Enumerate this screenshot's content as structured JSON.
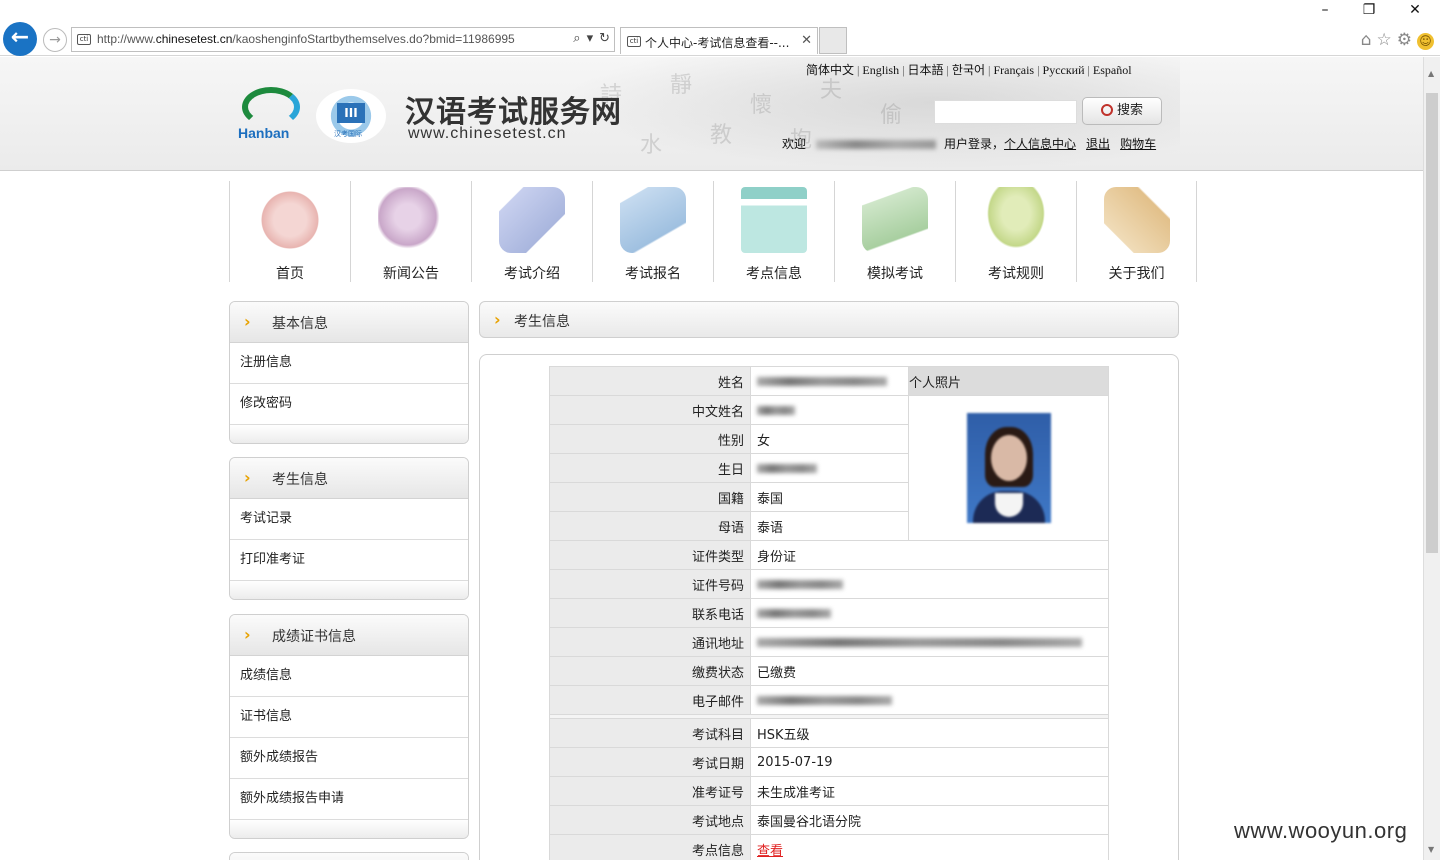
{
  "window": {
    "minimize": "–",
    "restore": "❐",
    "close": "✕"
  },
  "browser": {
    "url_prefix": "http://www.",
    "url_domain": "chinesetest.cn",
    "url_path": "/kaoshenginfoStartbythemselves.do?bmid=11986995",
    "favicon_text": "cti",
    "tab_title": "个人中心-考试信息查看--...",
    "icons": [
      "back-arrow-icon",
      "forward-arrow-icon",
      "search-icon",
      "dropdown-icon",
      "refresh-icon",
      "home-icon",
      "star-icon",
      "gear-icon",
      "smiley-icon"
    ]
  },
  "header": {
    "site_title": "汉语考试服务网",
    "site_url": "www.chinesetest.cn",
    "logo_text": "Hanban",
    "logo2_caption": "汉考国际",
    "languages": [
      "简体中文",
      "English",
      "日本語",
      "한국어",
      "Français",
      "Русский",
      "Español"
    ],
    "search_button": "搜索",
    "welcome": "欢迎",
    "user_login": "用户登录，",
    "personal_center": "个人信息中心",
    "logout": "退出",
    "cart": "购物车"
  },
  "nav": {
    "items": [
      {
        "label": "首页",
        "color": "#e8b4b0"
      },
      {
        "label": "新闻公告",
        "color": "#c9a7c9"
      },
      {
        "label": "考试介绍",
        "color": "#a9b6de"
      },
      {
        "label": "考试报名",
        "color": "#9fc0e0"
      },
      {
        "label": "考点信息",
        "color": "#8fd0c8"
      },
      {
        "label": "模拟考试",
        "color": "#a8cfa0"
      },
      {
        "label": "考试规则",
        "color": "#c4d88a"
      },
      {
        "label": "关于我们",
        "color": "#e2c08a"
      }
    ]
  },
  "sidebar": {
    "panels": [
      {
        "title": "基本信息",
        "items": [
          "注册信息",
          "修改密码"
        ]
      },
      {
        "title": "考生信息",
        "items": [
          "考试记录",
          "打印准考证"
        ]
      },
      {
        "title": "成绩证书信息",
        "items": [
          "成绩信息",
          "证书信息",
          "额外成绩报告",
          "额外成绩报告申请"
        ]
      }
    ]
  },
  "main": {
    "title": "考生信息",
    "photo_label": "个人照片",
    "rows_personal": [
      {
        "label": "姓名",
        "value": ""
      },
      {
        "label": "中文姓名",
        "value": ""
      },
      {
        "label": "性别",
        "value": "女"
      },
      {
        "label": "生日",
        "value": ""
      },
      {
        "label": "国籍",
        "value": "泰国"
      },
      {
        "label": "母语",
        "value": "泰语"
      }
    ],
    "rows_contact": [
      {
        "label": "证件类型",
        "value": "身份证"
      },
      {
        "label": "证件号码",
        "value": ""
      },
      {
        "label": "联系电话",
        "value": ""
      },
      {
        "label": "通讯地址",
        "value": ""
      },
      {
        "label": "缴费状态",
        "value": "已缴费"
      },
      {
        "label": "电子邮件",
        "value": ""
      }
    ],
    "rows_exam": [
      {
        "label": "考试科目",
        "value": "HSK五级"
      },
      {
        "label": "考试日期",
        "value": "2015-07-19"
      },
      {
        "label": "准考证号",
        "value": "未生成准考证"
      },
      {
        "label": "考试地点",
        "value": "泰国曼谷北语分院"
      },
      {
        "label": "考点信息",
        "value": "查看"
      }
    ]
  },
  "watermark": "www.wooyun.org"
}
